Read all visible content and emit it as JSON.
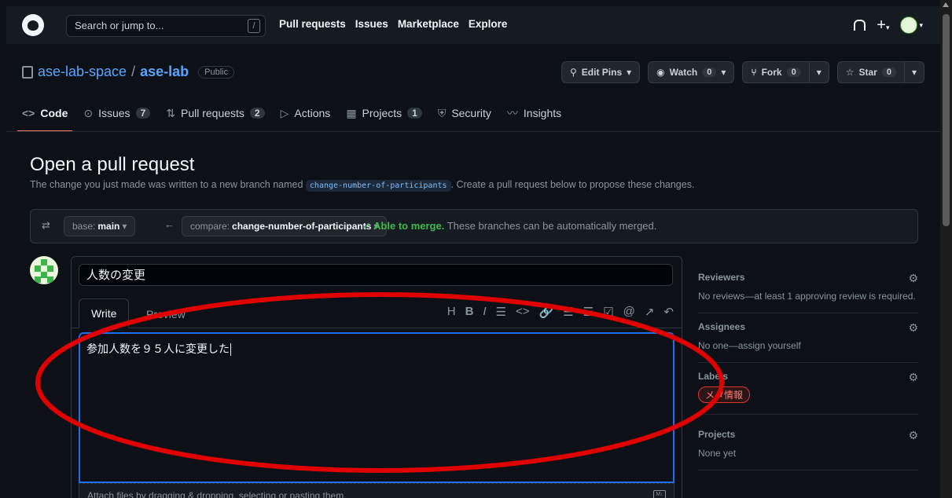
{
  "header": {
    "search_placeholder": "Search or jump to...",
    "search_key": "/",
    "nav": [
      "Pull requests",
      "Issues",
      "Marketplace",
      "Explore"
    ]
  },
  "repo": {
    "owner": "ase-lab-space",
    "separator": "/",
    "name": "ase-lab",
    "visibility": "Public",
    "edit_pins": "Edit Pins",
    "watch": "Watch",
    "watch_count": "0",
    "fork": "Fork",
    "fork_count": "0",
    "star": "Star",
    "star_count": "0"
  },
  "tabs": [
    {
      "label": "Code",
      "icon": "<>"
    },
    {
      "label": "Issues",
      "count": "7",
      "icon": "⊙"
    },
    {
      "label": "Pull requests",
      "count": "2",
      "icon": "⇅"
    },
    {
      "label": "Actions",
      "icon": "▷"
    },
    {
      "label": "Projects",
      "count": "1",
      "icon": "▦"
    },
    {
      "label": "Security",
      "icon": "⛨"
    },
    {
      "label": "Insights",
      "icon": "〰"
    }
  ],
  "pr": {
    "title": "Open a pull request",
    "desc_before": "The change you just made was written to a new branch named ",
    "branch": "change-number-of-participants",
    "desc_after": ". Create a pull request below to propose these changes."
  },
  "compare": {
    "base_prefix": "base:",
    "base": "main",
    "compare_prefix": "compare:",
    "compare": "change-number-of-participants",
    "able": "Able to merge.",
    "merge_text": "These branches can be automatically merged."
  },
  "form": {
    "title_value": "人数の変更",
    "tab_write": "Write",
    "tab_preview": "Preview",
    "body_value": "参加人数を９５人に変更した",
    "attach_text": "Attach files by dragging & dropping, selecting or pasting them.",
    "toolbar": [
      "H",
      "B",
      "I",
      "☰",
      "<>",
      "🔗",
      "☰",
      "☰",
      "☑",
      "@",
      "↗",
      "↶"
    ]
  },
  "sidebar": {
    "reviewers_h": "Reviewers",
    "reviewers_v": "No reviews—at least 1 approving review is required.",
    "assignees_h": "Assignees",
    "assignees_v": "No one—assign yourself",
    "labels_h": "Labels",
    "label_chip": "メタ情報",
    "projects_h": "Projects",
    "projects_v": "None yet"
  },
  "colors": {
    "background": "#0d1117",
    "link": "#58a6ff",
    "success": "#3fb950",
    "annotation": "#e00000"
  }
}
